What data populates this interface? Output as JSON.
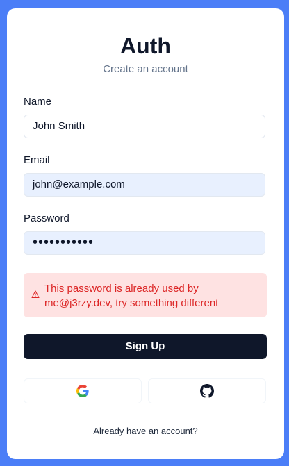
{
  "header": {
    "title": "Auth",
    "subtitle": "Create an account"
  },
  "form": {
    "name_label": "Name",
    "name_value": "John Smith",
    "email_label": "Email",
    "email_value": "john@example.com",
    "password_label": "Password",
    "password_value": "•••••••••••"
  },
  "alert": {
    "icon": "warning-icon",
    "message": "This password is already used by me@j3rzy.dev, try something different"
  },
  "actions": {
    "signup_label": "Sign Up",
    "google_icon": "google-icon",
    "github_icon": "github-icon",
    "login_link": "Already have an account?"
  },
  "colors": {
    "background": "#4b7ef7",
    "primary": "#0f172a",
    "error_bg": "#fee2e2",
    "error_text": "#dc2626",
    "autofill_bg": "#e8f0fe"
  }
}
